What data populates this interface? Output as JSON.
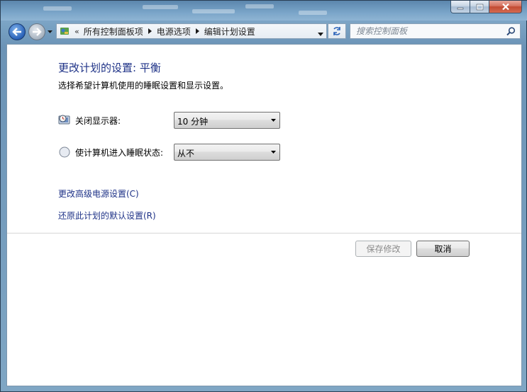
{
  "address_bar": {
    "overflow": "«",
    "crumbs": [
      "所有控制面板项",
      "电源选项",
      "编辑计划设置"
    ]
  },
  "search": {
    "placeholder": "搜索控制面板"
  },
  "main": {
    "title": "更改计划的设置: 平衡",
    "subtitle": "选择希望计算机使用的睡眠设置和显示设置。",
    "display_off": {
      "label": "关闭显示器:",
      "value": "10 分钟"
    },
    "sleep": {
      "label": "使计算机进入睡眠状态:",
      "value": "从不"
    },
    "link_advanced": "更改高级电源设置(C)",
    "link_restore": "还原此计划的默认设置(R)"
  },
  "buttons": {
    "save": "保存修改",
    "cancel": "取消"
  },
  "colors": {
    "title": "#1e3287",
    "link": "#1e3287",
    "accent": "#2a62b8"
  }
}
